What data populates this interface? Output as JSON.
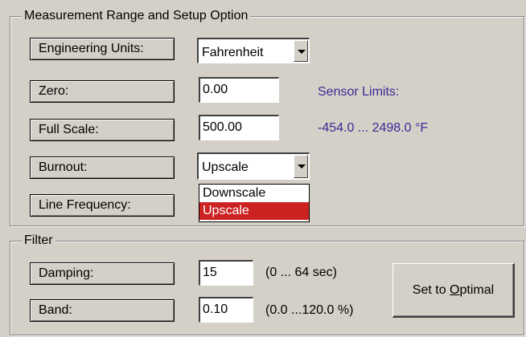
{
  "measurement_group": {
    "title": "Measurement Range and Setup Option",
    "engineering_units_label": "Engineering Units:",
    "engineering_units_value": "Fahrenheit",
    "zero_label": "Zero:",
    "zero_value": "0.00",
    "full_scale_label": "Full Scale:",
    "full_scale_value": "500.00",
    "burnout_label": "Burnout:",
    "burnout_value": "Upscale",
    "line_frequency_label": "Line Frequency:",
    "sensor_limits_label": "Sensor Limits:",
    "sensor_limits_value": "-454.0 ... 2498.0 °F",
    "burnout_options": [
      "Downscale",
      "Upscale"
    ],
    "burnout_selected_option": "Upscale"
  },
  "filter_group": {
    "title": "Filter",
    "damping_label": "Damping:",
    "damping_value": "15",
    "damping_range": "(0 ... 64 sec)",
    "band_label": "Band:",
    "band_value": "0.10",
    "band_range": "(0.0 ...120.0 %)",
    "optimal_button_prefix": "Set to ",
    "optimal_button_mnemonic": "O",
    "optimal_button_suffix": "ptimal"
  },
  "colors": {
    "window_bg": "#d4d0c8",
    "info_text": "#3c2896",
    "selection_highlight": "#cc2222"
  }
}
